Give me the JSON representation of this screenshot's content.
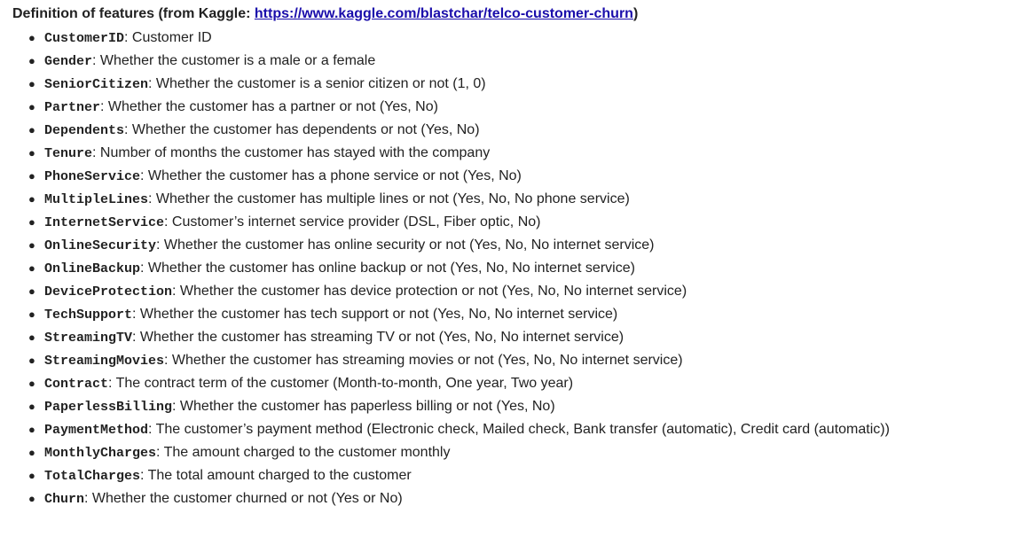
{
  "heading": {
    "prefix": "Definition of features (from Kaggle: ",
    "link_text": "https://www.kaggle.com/blastchar/telco-customer-churn",
    "suffix": ")"
  },
  "features": [
    {
      "name": "CustomerID",
      "desc": ": Customer ID"
    },
    {
      "name": "Gender",
      "desc": ": Whether the customer is a male or a female"
    },
    {
      "name": "SeniorCitizen",
      "desc": ": Whether the customer is a senior citizen or not (1, 0)"
    },
    {
      "name": "Partner",
      "desc": ": Whether the customer has a partner or not (Yes, No)"
    },
    {
      "name": "Dependents",
      "desc": ": Whether the customer has dependents or not (Yes, No)"
    },
    {
      "name": "Tenure",
      "desc": ": Number of months the customer has stayed with the company"
    },
    {
      "name": "PhoneService",
      "desc": ": Whether the customer has a phone service or not (Yes, No)"
    },
    {
      "name": "MultipleLines",
      "desc": ": Whether the customer has multiple lines or not (Yes, No, No phone service)"
    },
    {
      "name": "InternetService",
      "desc": ": Customer’s internet service provider (DSL, Fiber optic, No)"
    },
    {
      "name": "OnlineSecurity",
      "desc": ": Whether the customer has online security or not (Yes, No, No internet service)"
    },
    {
      "name": "OnlineBackup",
      "desc": ": Whether the customer has online backup or not (Yes, No, No internet service)"
    },
    {
      "name": "DeviceProtection",
      "desc": ": Whether the customer has device protection or not (Yes, No, No internet service)"
    },
    {
      "name": "TechSupport",
      "desc": ": Whether the customer has tech support or not (Yes, No, No internet service)"
    },
    {
      "name": "StreamingTV",
      "desc": ": Whether the customer has streaming TV or not (Yes, No, No internet service)"
    },
    {
      "name": "StreamingMovies",
      "desc": ": Whether the customer has streaming movies or not (Yes, No, No internet service)"
    },
    {
      "name": "Contract",
      "desc": ": The contract term of the customer (Month-to-month, One year, Two year)"
    },
    {
      "name": "PaperlessBilling",
      "desc": ": Whether the customer has paperless billing or not (Yes, No)"
    },
    {
      "name": "PaymentMethod",
      "desc": ": The customer’s payment method (Electronic check, Mailed check, Bank transfer (automatic), Credit card (automatic))"
    },
    {
      "name": "MonthlyCharges",
      "desc": ": The amount charged to the customer monthly"
    },
    {
      "name": "TotalCharges",
      "desc": ": The total amount charged to the customer"
    },
    {
      "name": "Churn",
      "desc": ": Whether the customer churned or not (Yes or No)"
    }
  ]
}
